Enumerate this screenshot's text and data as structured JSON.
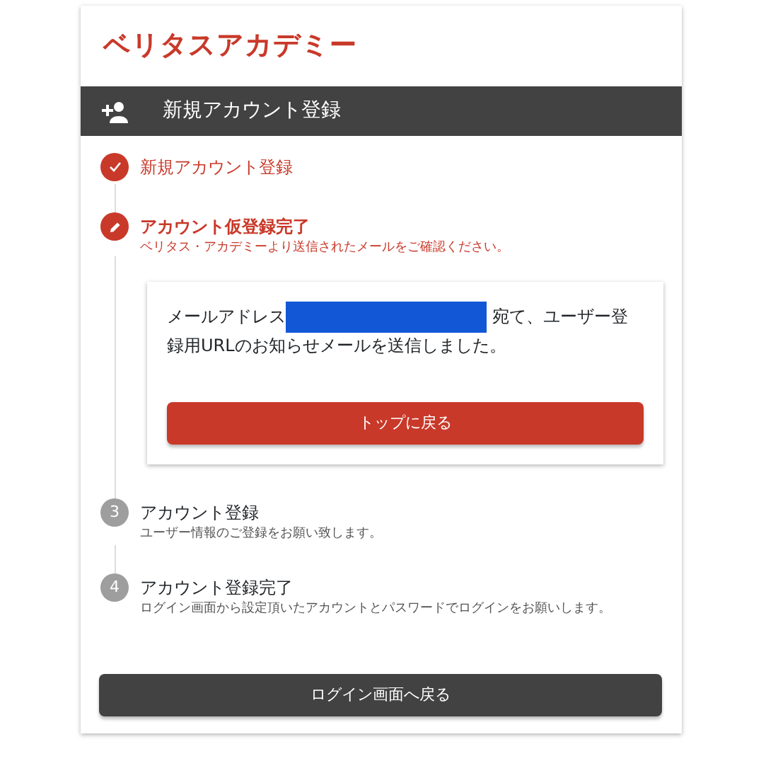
{
  "logo": "ベリタスアカデミー",
  "header": {
    "title": "新規アカウント登録"
  },
  "steps": [
    {
      "completed": true,
      "current": false,
      "title": "新規アカウント登録"
    },
    {
      "completed": false,
      "current": true,
      "title": "アカウント仮登録完了",
      "subtitle": "ベリタス・アカデミーより送信されたメールをご確認ください。",
      "message": {
        "before": "メールアドレス",
        "after": "宛て、ユーザー登録用URLのお知らせメールを送信しました。"
      },
      "button": "トップに戻る"
    },
    {
      "completed": false,
      "current": false,
      "marker": "3",
      "title": "アカウント登録",
      "subtitle": "ユーザー情報のご登録をお願い致します。"
    },
    {
      "completed": false,
      "current": false,
      "marker": "4",
      "title": "アカウント登録完了",
      "subtitle": "ログイン画面から設定頂いたアカウントとパスワードでログインをお願いします。"
    }
  ],
  "footer_button": "ログイン画面へ戻る"
}
